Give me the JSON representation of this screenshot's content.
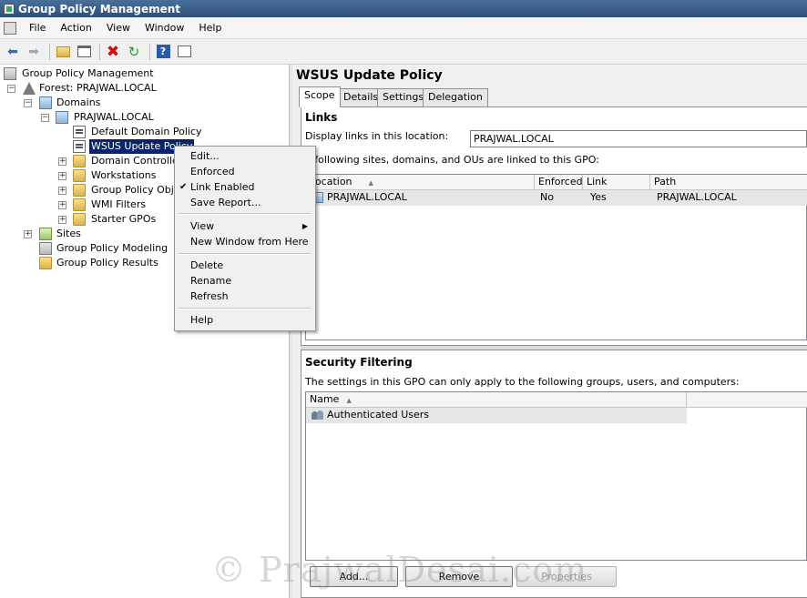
{
  "window": {
    "title": "Group Policy Management"
  },
  "menu": [
    "File",
    "Action",
    "View",
    "Window",
    "Help"
  ],
  "toolbar": {
    "icons": [
      "back-arrow-icon",
      "forward-arrow-icon",
      "up-folder-icon",
      "show-hide-tree-icon",
      "delete-icon",
      "refresh-icon",
      "help-icon",
      "properties-icon"
    ]
  },
  "tree": {
    "root": "Group Policy Management",
    "forest": "Forest: PRAJWAL.LOCAL",
    "domains": "Domains",
    "domain": "PRAJWAL.LOCAL",
    "default_policy": "Default Domain Policy",
    "wsus_policy": "WSUS Update Policy",
    "domain_controllers": "Domain Controllers",
    "workstations": "Workstations",
    "gpo_objects": "Group Policy Objects",
    "wmi_filters": "WMI Filters",
    "starter_gpos": "Starter GPOs",
    "sites": "Sites",
    "modeling": "Group Policy Modeling",
    "results": "Group Policy Results"
  },
  "context_menu": {
    "edit": "Edit...",
    "enforced": "Enforced",
    "link_enabled": "Link Enabled",
    "save_report": "Save Report...",
    "view": "View",
    "new_window": "New Window from Here",
    "delete": "Delete",
    "rename": "Rename",
    "refresh": "Refresh",
    "help": "Help"
  },
  "details": {
    "title": "WSUS Update Policy",
    "tabs": [
      "Scope",
      "Details",
      "Settings",
      "Delegation"
    ],
    "links_heading": "Links",
    "display_links_label": "Display links in this location:",
    "display_links_value": "PRAJWAL.LOCAL",
    "linked_desc": "e following sites, domains, and OUs are linked to this GPO:",
    "links_columns": [
      "Location",
      "Enforced",
      "Link Enabled",
      "Path"
    ],
    "links_rows": [
      {
        "location": "PRAJWAL.LOCAL",
        "enforced": "No",
        "link_enabled": "Yes",
        "path": "PRAJWAL.LOCAL"
      }
    ],
    "security_heading": "Security Filtering",
    "security_desc": "The settings in this GPO can only apply to the following groups, users, and computers:",
    "security_columns": [
      "Name"
    ],
    "security_rows": [
      "Authenticated Users"
    ],
    "buttons": {
      "add": "Add...",
      "remove": "Remove",
      "properties": "Properties"
    }
  },
  "watermark": "© PrajwalDesai.com"
}
